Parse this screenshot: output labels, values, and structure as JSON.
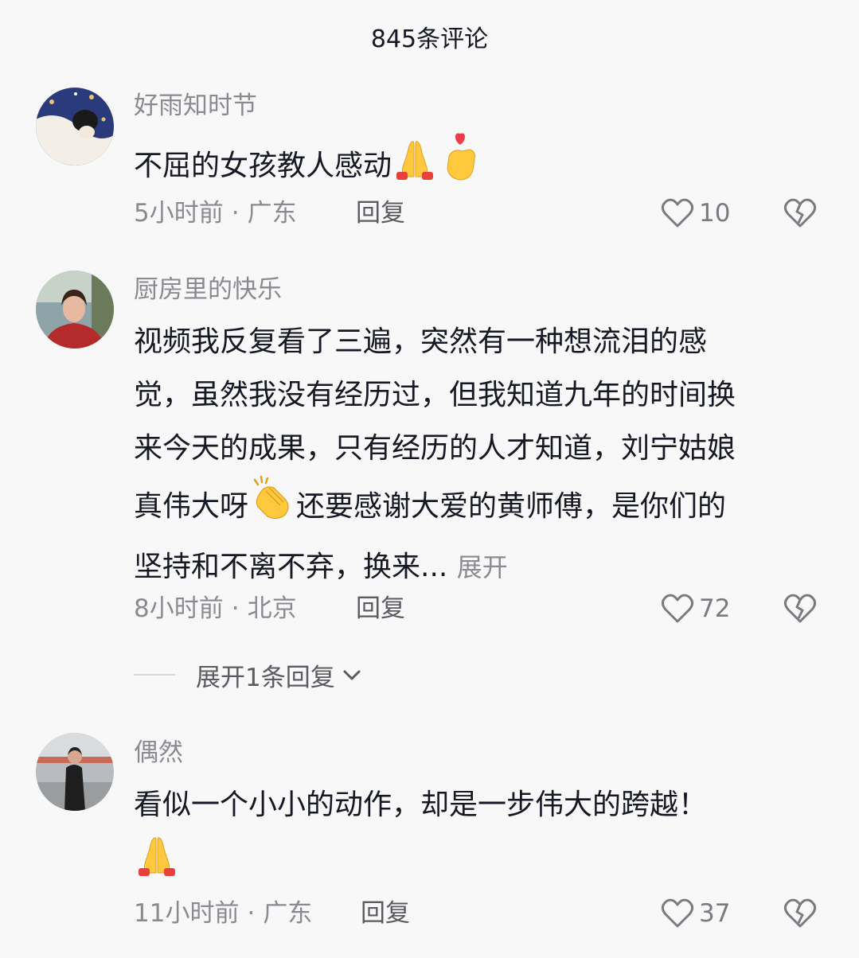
{
  "header": {
    "title": "845条评论"
  },
  "comments": [
    {
      "username": "好雨知时节",
      "content": "不屈的女孩教人感动",
      "time": "5小时前",
      "location": "广东",
      "reply_label": "回复",
      "likes": "10",
      "emojis": [
        "folded-hands",
        "heart-hands"
      ]
    },
    {
      "username": "厨房里的快乐",
      "lines": [
        "视频我反复看了三遍，突然有一种想流泪的感",
        "觉，虽然我没有经历过，但我知道九年的时间换",
        "来今天的成果，只有经历的人才知道，刘宁姑娘",
        "真伟大呀",
        "还要感谢大爱的黄师傅，是你们的",
        "坚持和不离不弃，换来..."
      ],
      "expand_label": "展开",
      "time": "8小时前",
      "location": "北京",
      "reply_label": "回复",
      "likes": "72",
      "emojis": [
        "clapping-hands"
      ]
    },
    {
      "username": "偶然",
      "content": "看似一个小小的动作，却是一步伟大的跨越！",
      "time": "11小时前",
      "location": "广东",
      "reply_label": "回复",
      "likes": "37",
      "emojis": [
        "folded-hands"
      ]
    }
  ],
  "expand_replies": {
    "label": "展开1条回复"
  },
  "separator": "·"
}
